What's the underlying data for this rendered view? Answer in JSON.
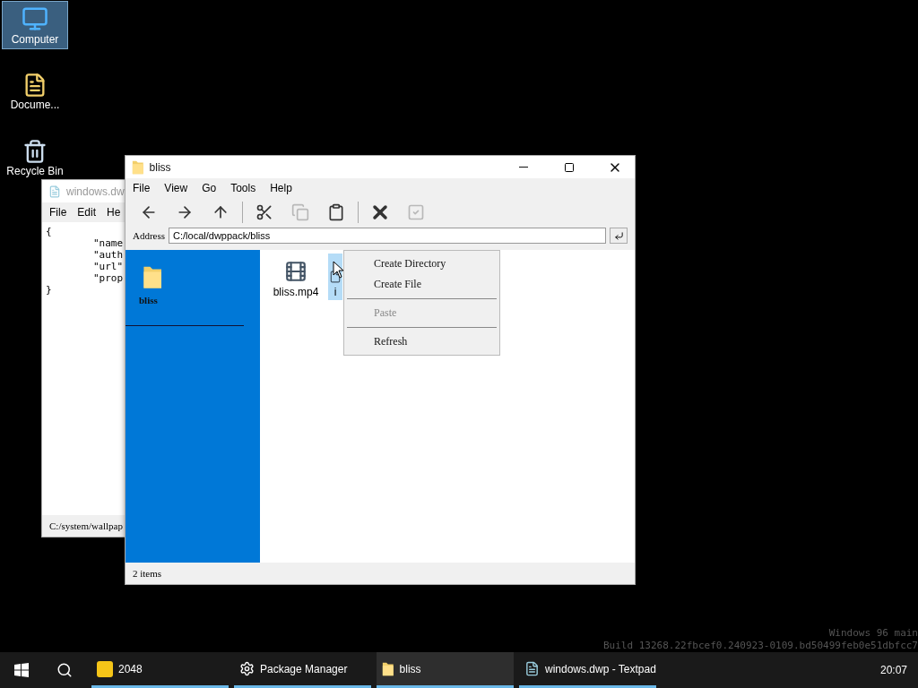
{
  "desktop_icons": [
    {
      "kind": "computer",
      "label": "Computer",
      "selected": true
    },
    {
      "kind": "documents",
      "label": "Docume...",
      "selected": false
    },
    {
      "kind": "recycle",
      "label": "Recycle Bin",
      "selected": false
    }
  ],
  "textpad": {
    "title": "windows.dw",
    "menu": [
      "File",
      "Edit",
      "He"
    ],
    "lines": [
      "{",
      "        \"name",
      "        \"auth",
      "        \"url\"",
      "        \"prop",
      "}"
    ],
    "status": "C:/system/wallpap"
  },
  "explorer": {
    "title": "bliss",
    "menu": [
      "File",
      "View",
      "Go",
      "Tools",
      "Help"
    ],
    "toolbar": [
      {
        "kind": "back",
        "disabled": false
      },
      {
        "kind": "forward",
        "disabled": false
      },
      {
        "kind": "up",
        "disabled": false
      },
      {
        "kind": "separator"
      },
      {
        "kind": "cut",
        "disabled": false
      },
      {
        "kind": "copy",
        "disabled": true
      },
      {
        "kind": "paste",
        "disabled": false
      },
      {
        "kind": "separator"
      },
      {
        "kind": "delete",
        "disabled": false
      },
      {
        "kind": "select",
        "disabled": true
      }
    ],
    "address": {
      "label": "Address",
      "value": "C:/local/dwppack/bliss"
    },
    "sidebar": {
      "folder": "bliss"
    },
    "files": [
      {
        "kind": "video",
        "name": "bliss.mp4",
        "selected": false
      },
      {
        "kind": "file",
        "name": "i",
        "selected": true
      }
    ],
    "context_menu": [
      {
        "kind": "item",
        "label": "Create Directory",
        "disabled": false
      },
      {
        "kind": "item",
        "label": "Create File",
        "disabled": false
      },
      {
        "kind": "separator"
      },
      {
        "kind": "item",
        "label": "Paste",
        "disabled": true
      },
      {
        "kind": "separator"
      },
      {
        "kind": "item",
        "label": "Refresh",
        "disabled": false
      }
    ],
    "status": "2 items"
  },
  "build_info": [
    "Windows 96 main",
    "Build 13268.22fbcef0.240923-0109.bd50499feb0e51dbfcc7"
  ],
  "taskbar": {
    "tasks": [
      {
        "kind": "game",
        "label": "2048",
        "active": false
      },
      {
        "kind": "gear",
        "label": "Package Manager",
        "active": false
      },
      {
        "kind": "folder",
        "label": "bliss",
        "active": true
      },
      {
        "kind": "textfile",
        "label": "windows.dwp - Textpad",
        "active": false
      }
    ],
    "clock": "20:07"
  }
}
